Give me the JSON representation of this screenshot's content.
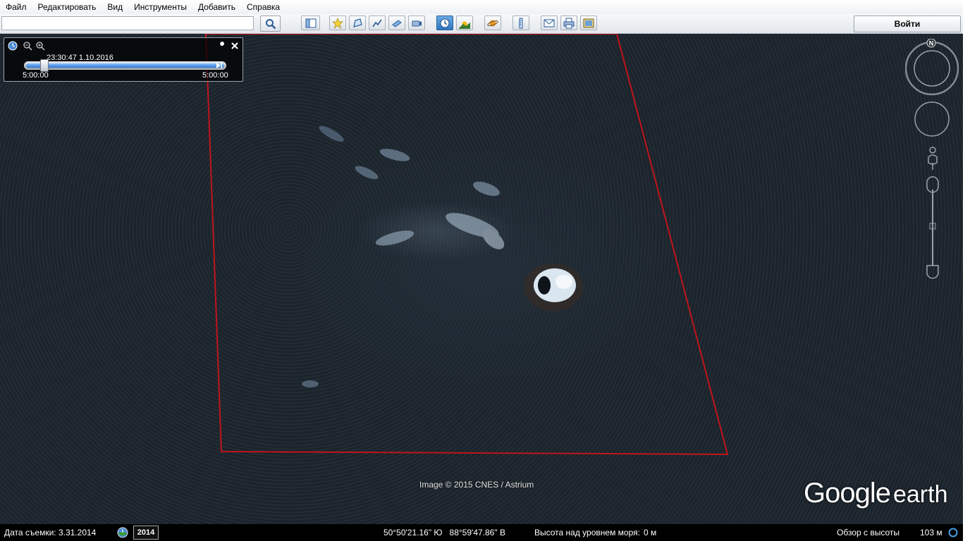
{
  "menu": [
    "Файл",
    "Редактировать",
    "Вид",
    "Инструменты",
    "Добавить",
    "Справка"
  ],
  "search": {
    "value": "",
    "placeholder": ""
  },
  "toolbar": {
    "buttons": [
      "sidebar-icon",
      "placemark-icon",
      "polygon-icon",
      "path-icon",
      "overlay-icon",
      "tour-icon",
      "historical-imagery-icon",
      "sunlight-icon",
      "planets-icon",
      "ruler-icon",
      "email-icon",
      "print-icon",
      "save-image-icon"
    ],
    "login_label": "Войти"
  },
  "time_slider": {
    "current": "23:30:47 1.10.2016",
    "range_start": "5:00:00",
    "range_end": "5:00:00",
    "position": 0.08
  },
  "map": {
    "attribution": "Image © 2015 CNES / Astrium",
    "logo_google": "Google",
    "logo_earth": "earth",
    "boundary_color": "#c0141c"
  },
  "status": {
    "capture_date": "Дата съемки: 3.31.2014",
    "year": "2014",
    "coords": "50°50'21.16\" Ю   88°59'47.86\" В",
    "elevation_label": "Высота над уровнем моря:",
    "elevation_value": "0 м",
    "eye_alt_label": "Обзор с высоты",
    "eye_alt_value": "103 м"
  }
}
